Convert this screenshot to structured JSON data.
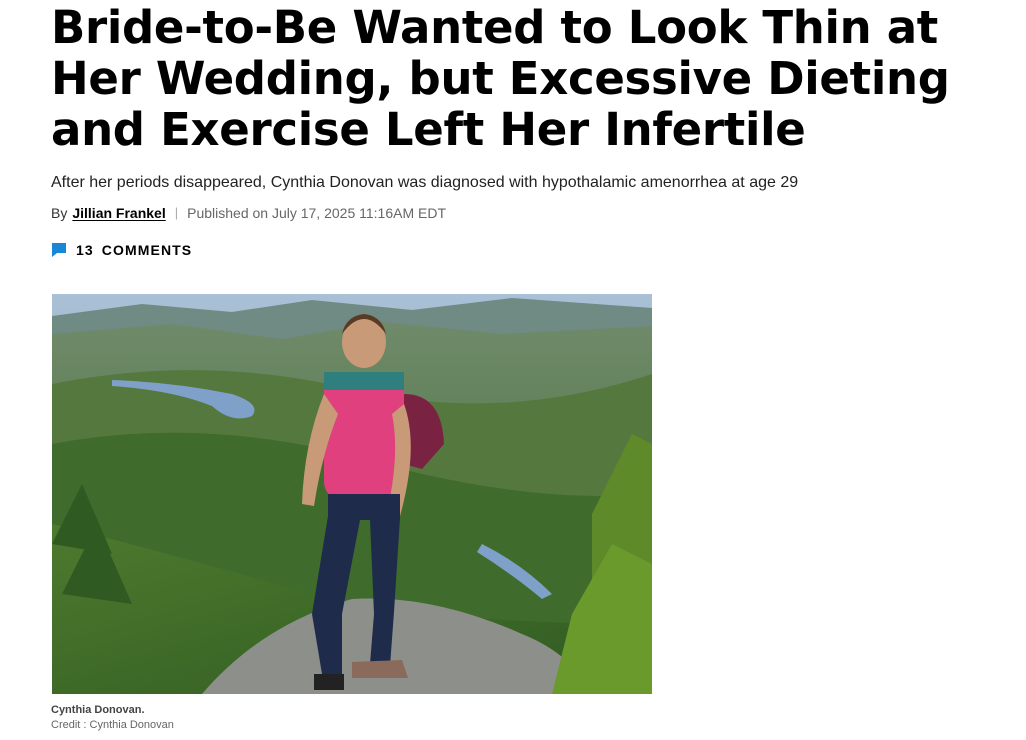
{
  "article": {
    "headline": "Bride-to-Be Wanted to Look Thin at Her Wedding, but Excessive Dieting and Exercise Left Her Infertile",
    "dek": "After her periods disappeared, Cynthia Donovan was diagnosed with hypothalamic amenorrhea at age 29",
    "byline": {
      "prefix": "By",
      "author": "Jillian Frankel",
      "separator": "|",
      "published": "Published on July 17, 2025 11:16AM EDT"
    },
    "comments": {
      "icon": "comment-bubble-icon",
      "count": "13",
      "label": "COMMENTS"
    },
    "image": {
      "caption": "Cynthia Donovan.",
      "credit": "Credit : Cynthia Donovan"
    },
    "colors": {
      "comment_icon": "#1a86d6",
      "headline": "#000000"
    }
  }
}
